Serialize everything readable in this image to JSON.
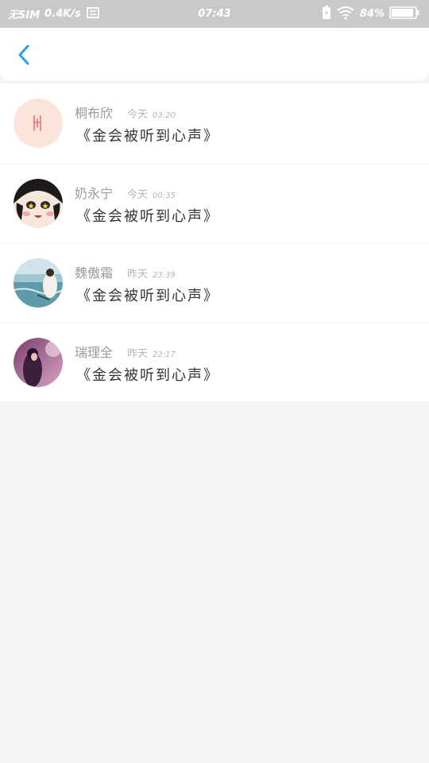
{
  "status_bar": {
    "carrier": "无SIM",
    "net_speed": "0.4K/s",
    "time": "07:43",
    "battery_percent": "84%"
  },
  "conversations": [
    {
      "name": "桐布欣",
      "day": "今天",
      "clock": "03:20",
      "message": "《金会被听到心声》",
      "avatar": "pink-logo-avatar"
    },
    {
      "name": "奶永宁",
      "day": "今天",
      "clock": "00:35",
      "message": "《金会被听到心声》",
      "avatar": "cartoon-face-avatar"
    },
    {
      "name": "魏傲霜",
      "day": "昨天",
      "clock": "23:39",
      "message": "《金会被听到心声》",
      "avatar": "seaside-photo-avatar"
    },
    {
      "name": "瑞理全",
      "day": "昨天",
      "clock": "22:17",
      "message": "《金会被听到心声》",
      "avatar": "purple-photo-avatar"
    }
  ],
  "colors": {
    "accent": "#2b9fe6",
    "background": "#f5f5f5",
    "status_bar": "#c9c9c9"
  }
}
